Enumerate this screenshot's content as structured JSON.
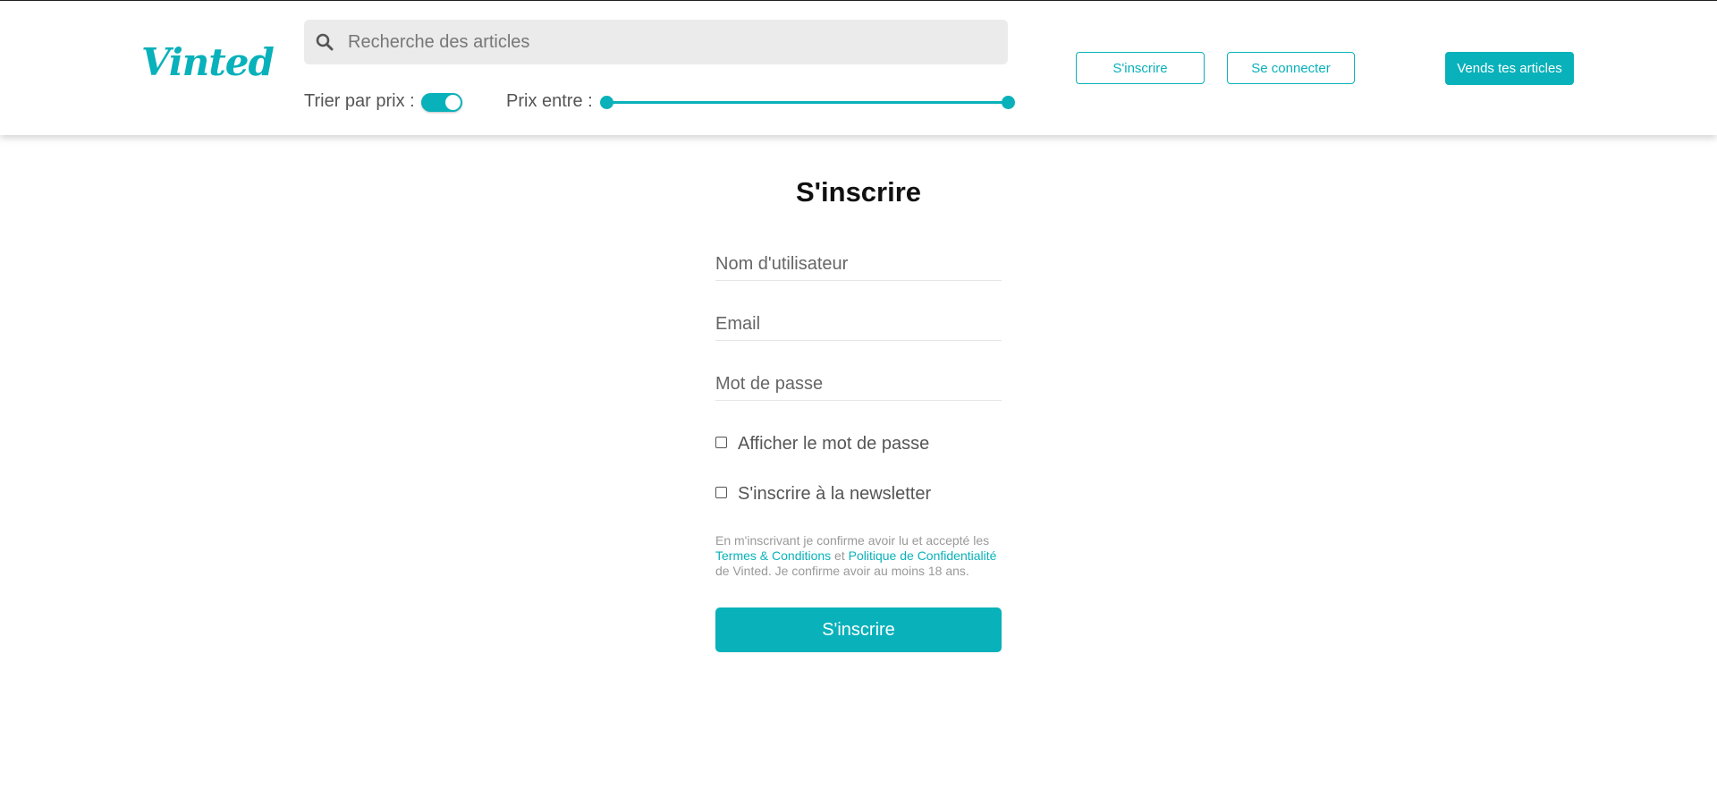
{
  "header": {
    "logo_text": "Vinted",
    "search": {
      "placeholder": "Recherche des articles",
      "value": "",
      "icon": "search-icon"
    },
    "sort_label": "Trier par prix :",
    "sort_toggle_on": true,
    "price_label": "Prix entre :",
    "price_range": {
      "min_fraction": 0.0,
      "max_fraction": 1.0
    },
    "signup_label": "S'inscrire",
    "login_label": "Se connecter",
    "sell_label": "Vends tes articles"
  },
  "form": {
    "title": "S'inscrire",
    "username_placeholder": "Nom d'utilisateur",
    "email_placeholder": "Email",
    "password_placeholder": "Mot de passe",
    "show_password_label": "Afficher le mot de passe",
    "show_password_checked": false,
    "newsletter_label": "S'inscrire à la newsletter",
    "newsletter_checked": false,
    "legal": {
      "text_before": "En m'inscrivant je confirme avoir lu et accepté les ",
      "terms_link": "Termes & Conditions",
      "between": " et ",
      "privacy_link": "Politique de Confidentialité",
      "text_after": " de Vinted. Je confirme avoir au moins 18 ans."
    },
    "submit_label": "S'inscrire"
  },
  "colors": {
    "accent": "#09b1ba",
    "search_bg": "#ebebeb",
    "text": "#555555",
    "title": "#111111"
  }
}
